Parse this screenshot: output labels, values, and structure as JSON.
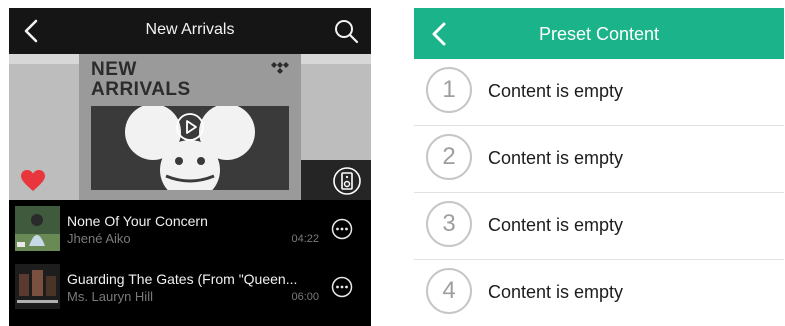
{
  "left": {
    "header": {
      "title": "New Arrivals"
    },
    "hero": {
      "text_line1": "NEW",
      "text_line2": "ARRIVALS"
    },
    "tracks": [
      {
        "title": "None Of Your Concern",
        "artist": "Jhené Aiko",
        "duration": "04:22"
      },
      {
        "title": "Guarding The Gates (From \"Queen...",
        "artist": "Ms. Lauryn Hill",
        "duration": "06:00"
      }
    ],
    "colors": {
      "background": "#000000",
      "heart": "#e8363c",
      "text": "#f0f0f0",
      "subtext": "#7a7a7a"
    },
    "icons": [
      "back-chevron-icon",
      "search-icon",
      "tidal-logo-icon",
      "play-icon",
      "heart-icon",
      "speaker-icon",
      "more-icon"
    ]
  },
  "right": {
    "header": {
      "title": "Preset Content"
    },
    "presets": [
      {
        "number": "1",
        "label": "Content is empty"
      },
      {
        "number": "2",
        "label": "Content is empty"
      },
      {
        "number": "3",
        "label": "Content is empty"
      },
      {
        "number": "4",
        "label": "Content is empty"
      }
    ],
    "colors": {
      "header": "#1ab38a",
      "header_text": "#ffffff",
      "circle": "#c6c6c6"
    },
    "icons": [
      "back-chevron-icon"
    ]
  }
}
